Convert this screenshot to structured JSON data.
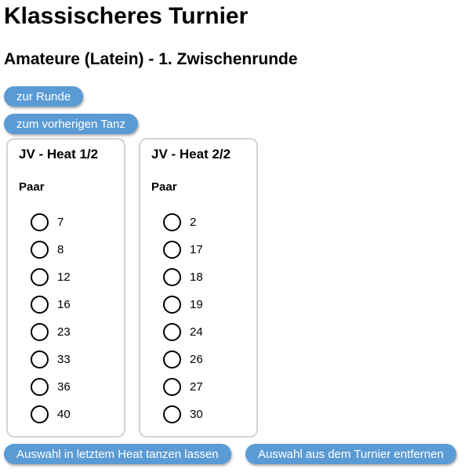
{
  "page": {
    "title": "Klassischeres Turnier",
    "subtitle": "Amateure (Latein) - 1. Zwischenrunde"
  },
  "nav": {
    "round_label": "zur Runde",
    "prev_dance_label": "zum vorherigen Tanz"
  },
  "heats": [
    {
      "title": "JV - Heat 1/2",
      "pair_header": "Paar",
      "pairs": [
        "7",
        "8",
        "12",
        "16",
        "23",
        "33",
        "36",
        "40"
      ]
    },
    {
      "title": "JV - Heat 2/2",
      "pair_header": "Paar",
      "pairs": [
        "2",
        "17",
        "18",
        "19",
        "24",
        "26",
        "27",
        "30"
      ]
    }
  ],
  "actions": {
    "dance_last_heat_label": "Auswahl in letztem Heat tanzen lassen",
    "remove_label": "Auswahl aus dem Turnier entfernen"
  },
  "colors": {
    "button": "#5b9bd5",
    "panel_border": "#d4d4d4"
  }
}
